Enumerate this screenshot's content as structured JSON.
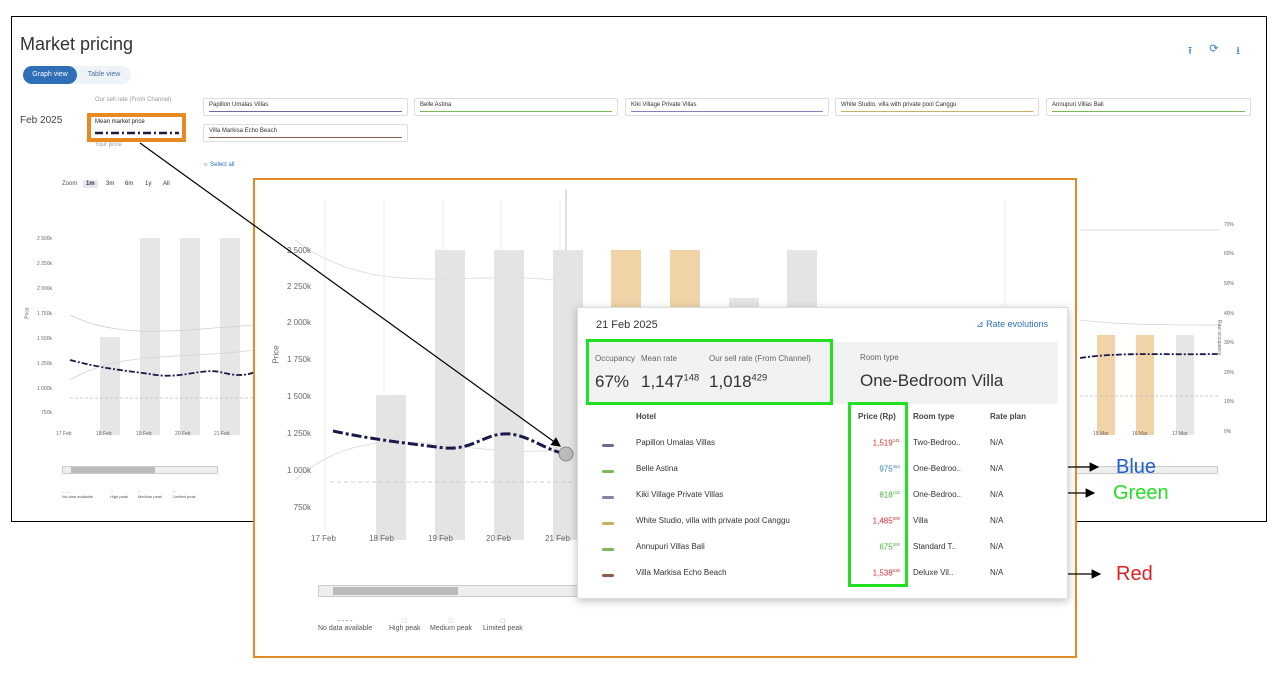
{
  "header": {
    "title": "Market pricing",
    "tools": [
      {
        "icon": "upload-icon",
        "glyph": "⭱"
      },
      {
        "icon": "refresh-icon",
        "glyph": "⟳"
      },
      {
        "icon": "download-icon",
        "glyph": "⭳"
      }
    ]
  },
  "view_toggle": {
    "graph": "Graph view",
    "table": "Table view"
  },
  "month": "Feb 2025",
  "legend": {
    "sell_rate": "Our sell rate (From Channel)",
    "mean_market": "Mean market price",
    "your_price": "Your price",
    "select_all": "Select all",
    "hotels": [
      {
        "name": "Papillon Umalas Villas",
        "color": "#6b6b9a"
      },
      {
        "name": "Belle Astina",
        "color": "#7ab85a"
      },
      {
        "name": "Kiki Village Private Villas",
        "color": "#8a7fb0"
      },
      {
        "name": "White Studio, villa with private pool Canggu",
        "color": "#c9b060"
      },
      {
        "name": "Annupuri Villas Bali",
        "color": "#7ab85a"
      },
      {
        "name": "Villa Markisa Echo Beach",
        "color": "#8a5a4a"
      }
    ]
  },
  "zoom": {
    "label": "Zoom",
    "options": [
      "1m",
      "3m",
      "6m",
      "1y",
      "All"
    ],
    "active": "1m"
  },
  "small_chart": {
    "ylabel": "Price",
    "yticks": [
      "2 500k",
      "2 250k",
      "2 000k",
      "1 750k",
      "1 500k",
      "1 250k",
      "1 000k",
      "750k"
    ],
    "xticks": [
      "17 Feb",
      "18 Feb",
      "19 Feb",
      "20 Feb",
      "21 Feb"
    ],
    "right_xticks": [
      "15 Mar",
      "16 Mar",
      "17 Mar"
    ],
    "right_yticks": [
      "70%",
      "60%",
      "50%",
      "40%",
      "30%",
      "20%",
      "10%",
      "0%"
    ],
    "right_ylabel": "Raw occupancy"
  },
  "big_chart": {
    "ylabel": "Price",
    "yticks": [
      "2 500k",
      "2 250k",
      "2 000k",
      "1 750k",
      "1 500k",
      "1 250k",
      "1 000k",
      "750k"
    ],
    "xticks": [
      "17 Feb",
      "18 Feb",
      "19 Feb",
      "20 Feb",
      "21 Feb"
    ]
  },
  "chart_footer": {
    "no_data": "No data available",
    "high": "High peak",
    "medium": "Medium peak",
    "limited": "Limited peak"
  },
  "tooltip": {
    "date": "21 Feb 2025",
    "rate_link": "Rate evolutions",
    "occupancy_label": "Occupancy",
    "mean_rate_label": "Mean rate",
    "sell_rate_label": "Our sell rate (From Channel)",
    "room_type_label": "Room type",
    "occupancy": "67%",
    "mean_rate_main": "1,147",
    "mean_rate_dec": "148",
    "sell_rate_main": "1,018",
    "sell_rate_dec": "429",
    "room_type": "One-Bedroom Villa",
    "table_headers": {
      "hotel": "Hotel",
      "price": "Price (Rp)",
      "room_type": "Room type",
      "rate_plan": "Rate plan"
    },
    "rows": [
      {
        "hotel": "Papillon Umalas Villas",
        "color": "#6b6b9a",
        "price": "1,519",
        "dec": "141",
        "price_color": "#d23030",
        "room": "Two-Bedroo..",
        "plan": "N/A"
      },
      {
        "hotel": "Belle Astina",
        "color": "#7ab85a",
        "price": "975",
        "dec": "454",
        "price_color": "#3a7fc0",
        "room": "One-Bedroo..",
        "plan": "N/A"
      },
      {
        "hotel": "Kiki Village Private Villas",
        "color": "#8a7fb0",
        "price": "818",
        "dec": "182",
        "price_color": "#4caf3f",
        "room": "One-Bedroo..",
        "plan": "N/A"
      },
      {
        "hotel": "White Studio, villa with private pool Canggu",
        "color": "#c9b060",
        "price": "1,485",
        "dec": "000",
        "price_color": "#d23030",
        "room": "Villa",
        "plan": "N/A"
      },
      {
        "hotel": "Annupuri Villas Bali",
        "color": "#7ab85a",
        "price": "675",
        "dec": "000",
        "price_color": "#4caf3f",
        "room": "Standard T..",
        "plan": "N/A"
      },
      {
        "hotel": "Villa Markisa Echo Beach",
        "color": "#8a5a4a",
        "price": "1,538",
        "dec": "630",
        "price_color": "#d23030",
        "room": "Deluxe Vil..",
        "plan": "N/A"
      }
    ]
  },
  "annotations": {
    "blue": {
      "text": "Blue",
      "color": "#1f5fd0"
    },
    "green": {
      "text": "Green",
      "color": "#22dd22"
    },
    "red": {
      "text": "Red",
      "color": "#e02020"
    }
  },
  "colors": {
    "accent": "#2f6fb8",
    "highlight_orange": "#e08a2a",
    "highlight_green": "#22e022",
    "mean_line": "#1a1a4a"
  }
}
